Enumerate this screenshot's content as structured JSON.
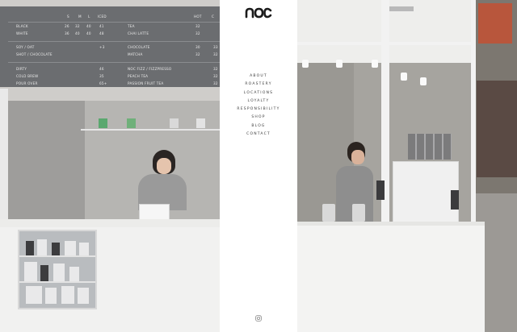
{
  "logo": {
    "text": "ɑɑɛ"
  },
  "nav": [
    {
      "label": "ABOUT"
    },
    {
      "label": "ROASTERY"
    },
    {
      "label": "LOCATIONS"
    },
    {
      "label": "LOYALTY"
    },
    {
      "label": "RESPONSIBILITY"
    },
    {
      "label": "SHOP"
    },
    {
      "label": "BLOG"
    },
    {
      "label": "CONTACT"
    }
  ],
  "footer": {
    "icon": "instagram-icon"
  },
  "menu_board": {
    "header": {
      "s": "S",
      "m": "M",
      "l": "L",
      "iced": "ICED",
      "hot": "HOT",
      "c": "C"
    },
    "rows": [
      {
        "left": "BLACK",
        "s": "26",
        "m": "32",
        "l": "40",
        "iced": "41",
        "right": "TEA",
        "hot": "32",
        "c": ""
      },
      {
        "left": "WHITE",
        "s": "36",
        "m": "40",
        "l": "40",
        "iced": "48",
        "right": "CHAI LATTE",
        "hot": "32",
        "c": ""
      },
      {
        "left": "SOY / OAT",
        "s": "",
        "m": "",
        "l": "",
        "iced": "+3",
        "right": "CHOCOLATE",
        "hot": "30",
        "c": "33"
      },
      {
        "left": "SHOT / CHOCOLATE",
        "s": "",
        "m": "",
        "l": "",
        "iced": "",
        "right": "MATCHA",
        "hot": "32",
        "c": "32"
      },
      {
        "left": "DIRTY",
        "s": "",
        "m": "",
        "l": "",
        "iced": "46",
        "right": "NOC FIZZ / FIZZPRESSO",
        "hot": "",
        "c": "32"
      },
      {
        "left": "COLD BREW",
        "s": "",
        "m": "",
        "l": "",
        "iced": "35",
        "right": "PEACH TEA",
        "hot": "",
        "c": "32"
      },
      {
        "left": "POUR OVER",
        "s": "",
        "m": "",
        "l": "",
        "iced": "65+",
        "right": "PASSION FRUIT TEA",
        "hot": "",
        "c": "32"
      }
    ]
  },
  "colors": {
    "board": "#6b6d70",
    "nav_text": "#3a3a3a",
    "logo": "#1b1b1b"
  }
}
